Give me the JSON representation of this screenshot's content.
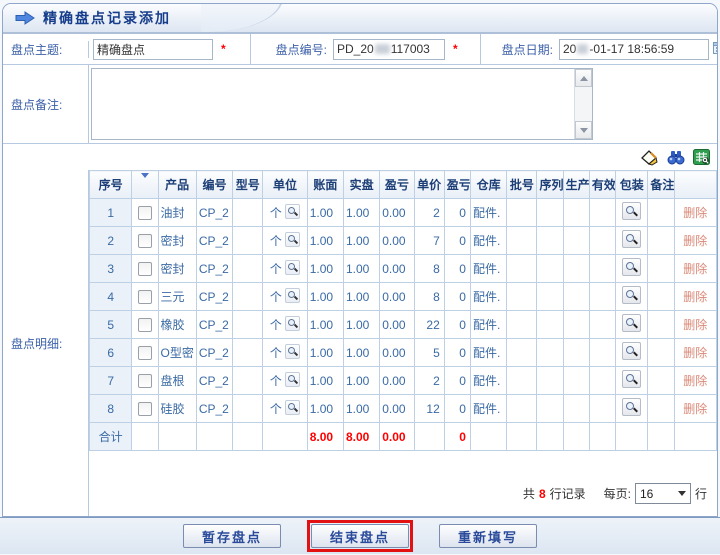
{
  "window": {
    "title": "精确盘点记录添加"
  },
  "form": {
    "subject_label": "盘点主题:",
    "subject_value": "精确盘点",
    "number_label": "盘点编号:",
    "number_prefix": "PD_20",
    "number_suffix": "117003",
    "date_label": "盘点日期:",
    "date_prefix": "20",
    "date_suffix": "-01-17 18:56:59",
    "remark_label": "盘点备注:",
    "detail_label": "盘点明细:",
    "required_mark": "*"
  },
  "table": {
    "headers": [
      "序号",
      "产品",
      "编号",
      "型号",
      "单位",
      "账面",
      "实盘",
      "盈亏",
      "单价",
      "盈亏",
      "仓库",
      "批号",
      "序列",
      "生产",
      "有效",
      "包装",
      "备注",
      ""
    ],
    "delete_label": "删除",
    "rows": [
      {
        "no": "1",
        "product": "油封",
        "code": "CP_2",
        "unit": "个",
        "book": "1.00",
        "actual": "1.00",
        "diff": "0.00",
        "price": "2",
        "profit": "0",
        "warehouse": "配件."
      },
      {
        "no": "2",
        "product": "密封",
        "code": "CP_2",
        "unit": "个",
        "book": "1.00",
        "actual": "1.00",
        "diff": "0.00",
        "price": "7",
        "profit": "0",
        "warehouse": "配件."
      },
      {
        "no": "3",
        "product": "密封",
        "code": "CP_2",
        "unit": "个",
        "book": "1.00",
        "actual": "1.00",
        "diff": "0.00",
        "price": "8",
        "profit": "0",
        "warehouse": "配件."
      },
      {
        "no": "4",
        "product": "三元",
        "code": "CP_2",
        "unit": "个",
        "book": "1.00",
        "actual": "1.00",
        "diff": "0.00",
        "price": "8",
        "profit": "0",
        "warehouse": "配件."
      },
      {
        "no": "5",
        "product": "橡胶",
        "code": "CP_2",
        "unit": "个",
        "book": "1.00",
        "actual": "1.00",
        "diff": "0.00",
        "price": "22",
        "profit": "0",
        "warehouse": "配件."
      },
      {
        "no": "6",
        "product": "O型密",
        "code": "CP_2",
        "unit": "个",
        "book": "1.00",
        "actual": "1.00",
        "diff": "0.00",
        "price": "5",
        "profit": "0",
        "warehouse": "配件."
      },
      {
        "no": "7",
        "product": "盘根",
        "code": "CP_2",
        "unit": "个",
        "book": "1.00",
        "actual": "1.00",
        "diff": "0.00",
        "price": "2",
        "profit": "0",
        "warehouse": "配件."
      },
      {
        "no": "8",
        "product": "硅胶",
        "code": "CP_2",
        "unit": "个",
        "book": "1.00",
        "actual": "1.00",
        "diff": "0.00",
        "price": "12",
        "profit": "0",
        "warehouse": "配件."
      }
    ],
    "sum": {
      "label": "合计",
      "book": "8.00",
      "actual": "8.00",
      "diff": "0.00",
      "profit": "0"
    }
  },
  "pager": {
    "total_prefix": "共",
    "count": "8",
    "total_suffix": "行记录",
    "per_label": "每页:",
    "per_value": "16",
    "row_unit": "行"
  },
  "buttons": {
    "save": "暂存盘点",
    "finish": "结束盘点",
    "reset": "重新填写"
  },
  "colors": {
    "title_blue": "#173e8c",
    "label_blue": "#3a5fa8",
    "cell_blue": "#3a6aa4",
    "sum_red": "#ff0000",
    "delete_red": "#d98877",
    "grid_border": "#bed0e4",
    "highlight_red": "#e31212"
  }
}
